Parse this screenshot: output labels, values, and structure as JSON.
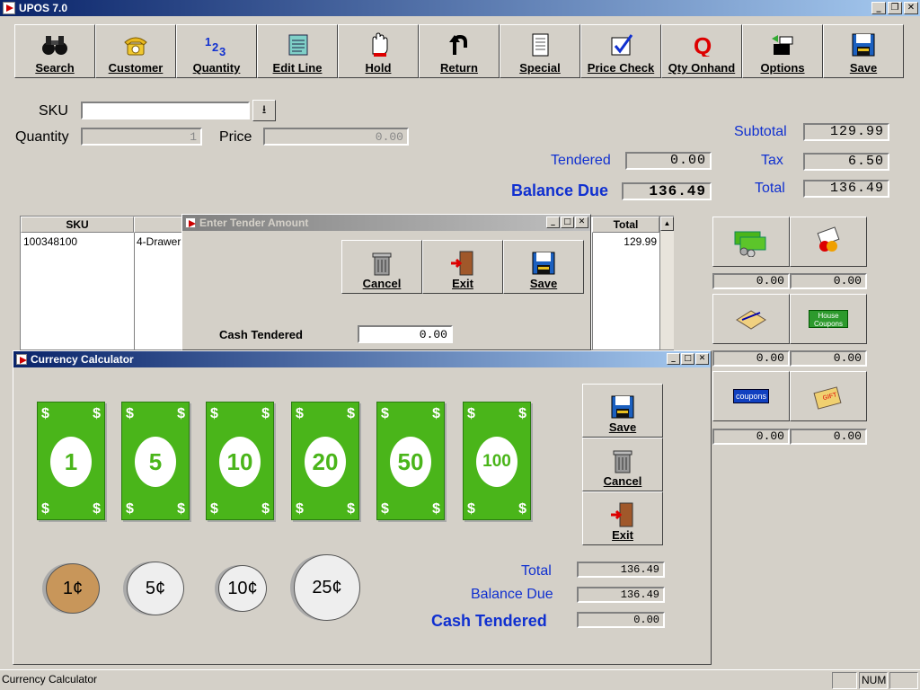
{
  "app": {
    "title": "UPOS 7.0"
  },
  "toolbar": [
    {
      "label": "Search",
      "icon": "binoculars-icon"
    },
    {
      "label": "Customer",
      "icon": "phone-icon"
    },
    {
      "label": "Quantity",
      "icon": "numbers-icon"
    },
    {
      "label": "Edit Line",
      "icon": "notepad-icon"
    },
    {
      "label": "Hold",
      "icon": "hand-icon"
    },
    {
      "label": "Return",
      "icon": "return-arrow-icon"
    },
    {
      "label": "Special",
      "icon": "document-icon"
    },
    {
      "label": "Price Check",
      "icon": "checkmark-icon"
    },
    {
      "label": "Qty Onhand",
      "icon": "q-icon"
    },
    {
      "label": "Options",
      "icon": "options-icon"
    },
    {
      "label": "Save",
      "icon": "floppy-disk-icon"
    }
  ],
  "entry": {
    "sku_label": "SKU",
    "sku_value": "",
    "quantity_label": "Quantity",
    "quantity_value": "1",
    "price_label": "Price",
    "price_value": "0.00"
  },
  "totals": {
    "tendered_label": "Tendered",
    "tendered_value": "0.00",
    "balance_due_label": "Balance Due",
    "balance_due_value": "136.49",
    "subtotal_label": "Subtotal",
    "subtotal_value": "129.99",
    "tax_label": "Tax",
    "tax_value": "6.50",
    "total_label": "Total",
    "total_value": "136.49"
  },
  "grid": {
    "headers": [
      "SKU",
      "Total"
    ],
    "rows": [
      {
        "sku": "100348100",
        "desc": "4-Drawer",
        "total": "129.99"
      }
    ]
  },
  "payments": {
    "values": [
      "0.00",
      "0.00",
      "0.00",
      "0.00",
      "0.00",
      "0.00"
    ],
    "icons": [
      "cash-icon",
      "credit-card-icon",
      "check-icon",
      "house-coupons-icon",
      "coupons-icon",
      "gift-card-icon"
    ],
    "house_coupons_text": "House Coupons",
    "coupons_text": "coupons",
    "gift_text": "GIFT"
  },
  "tender_dialog": {
    "title": "Enter Tender Amount",
    "cancel_label": "Cancel",
    "exit_label": "Exit",
    "save_label": "Save",
    "cash_tendered_label": "Cash Tendered",
    "cash_tendered_value": "0.00"
  },
  "calculator": {
    "title": "Currency Calculator",
    "bills": [
      "1",
      "5",
      "10",
      "20",
      "50",
      "100"
    ],
    "coins": [
      "1¢",
      "5¢",
      "10¢",
      "25¢"
    ],
    "dollar_sign": "$",
    "save_label": "Save",
    "cancel_label": "Cancel",
    "exit_label": "Exit",
    "total_label": "Total",
    "total_value": "136.49",
    "balance_due_label": "Balance Due",
    "balance_due_value": "136.49",
    "cash_tendered_label": "Cash Tendered",
    "cash_tendered_value": "0.00"
  },
  "status": {
    "text": "Currency Calculator",
    "num": "NUM"
  }
}
